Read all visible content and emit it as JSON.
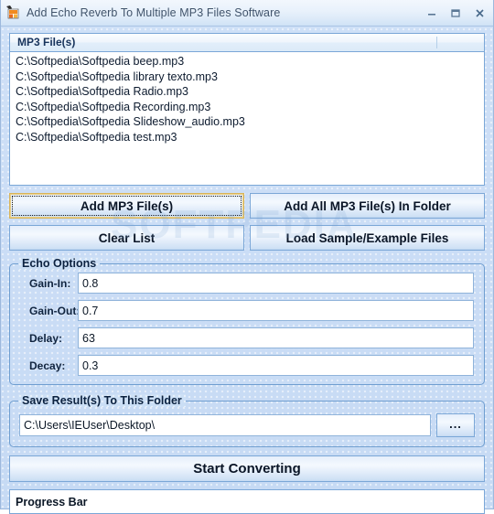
{
  "window": {
    "title": "Add Echo Reverb To Multiple MP3 Files Software",
    "icon": "app-icon",
    "controls": {
      "minimize": "–",
      "maximize": "▭",
      "close": "✕"
    }
  },
  "watermark": "SOFTPEDIA",
  "file_list": {
    "column_header": "MP3 File(s)",
    "rows": [
      "C:\\Softpedia\\Softpedia beep.mp3",
      "C:\\Softpedia\\Softpedia library texto.mp3",
      "C:\\Softpedia\\Softpedia Radio.mp3",
      "C:\\Softpedia\\Softpedia Recording.mp3",
      "C:\\Softpedia\\Softpedia Slideshow_audio.mp3",
      "C:\\Softpedia\\Softpedia test.mp3"
    ]
  },
  "buttons": {
    "add_files": "Add MP3 File(s)",
    "add_all_in_folder": "Add All MP3 File(s) In Folder",
    "clear_list": "Clear List",
    "load_samples": "Load Sample/Example Files",
    "browse": "...",
    "start_converting": "Start Converting"
  },
  "echo_options": {
    "title": "Echo Options",
    "fields": [
      {
        "label": "Gain-In:",
        "value": "0.8"
      },
      {
        "label": "Gain-Out:",
        "value": "0.7"
      },
      {
        "label": "Delay:",
        "value": "63"
      },
      {
        "label": "Decay:",
        "value": "0.3"
      }
    ]
  },
  "save_folder": {
    "title": "Save Result(s) To This Folder",
    "path": "C:\\Users\\IEUser\\Desktop\\"
  },
  "progress": {
    "text": "Progress Bar"
  },
  "colors": {
    "window_background": "#c8dcf5",
    "border_blue": "#7ba7d7",
    "focus_gold": "#d9b45a",
    "text_dark": "#0b1726",
    "title_text": "#41546b"
  }
}
